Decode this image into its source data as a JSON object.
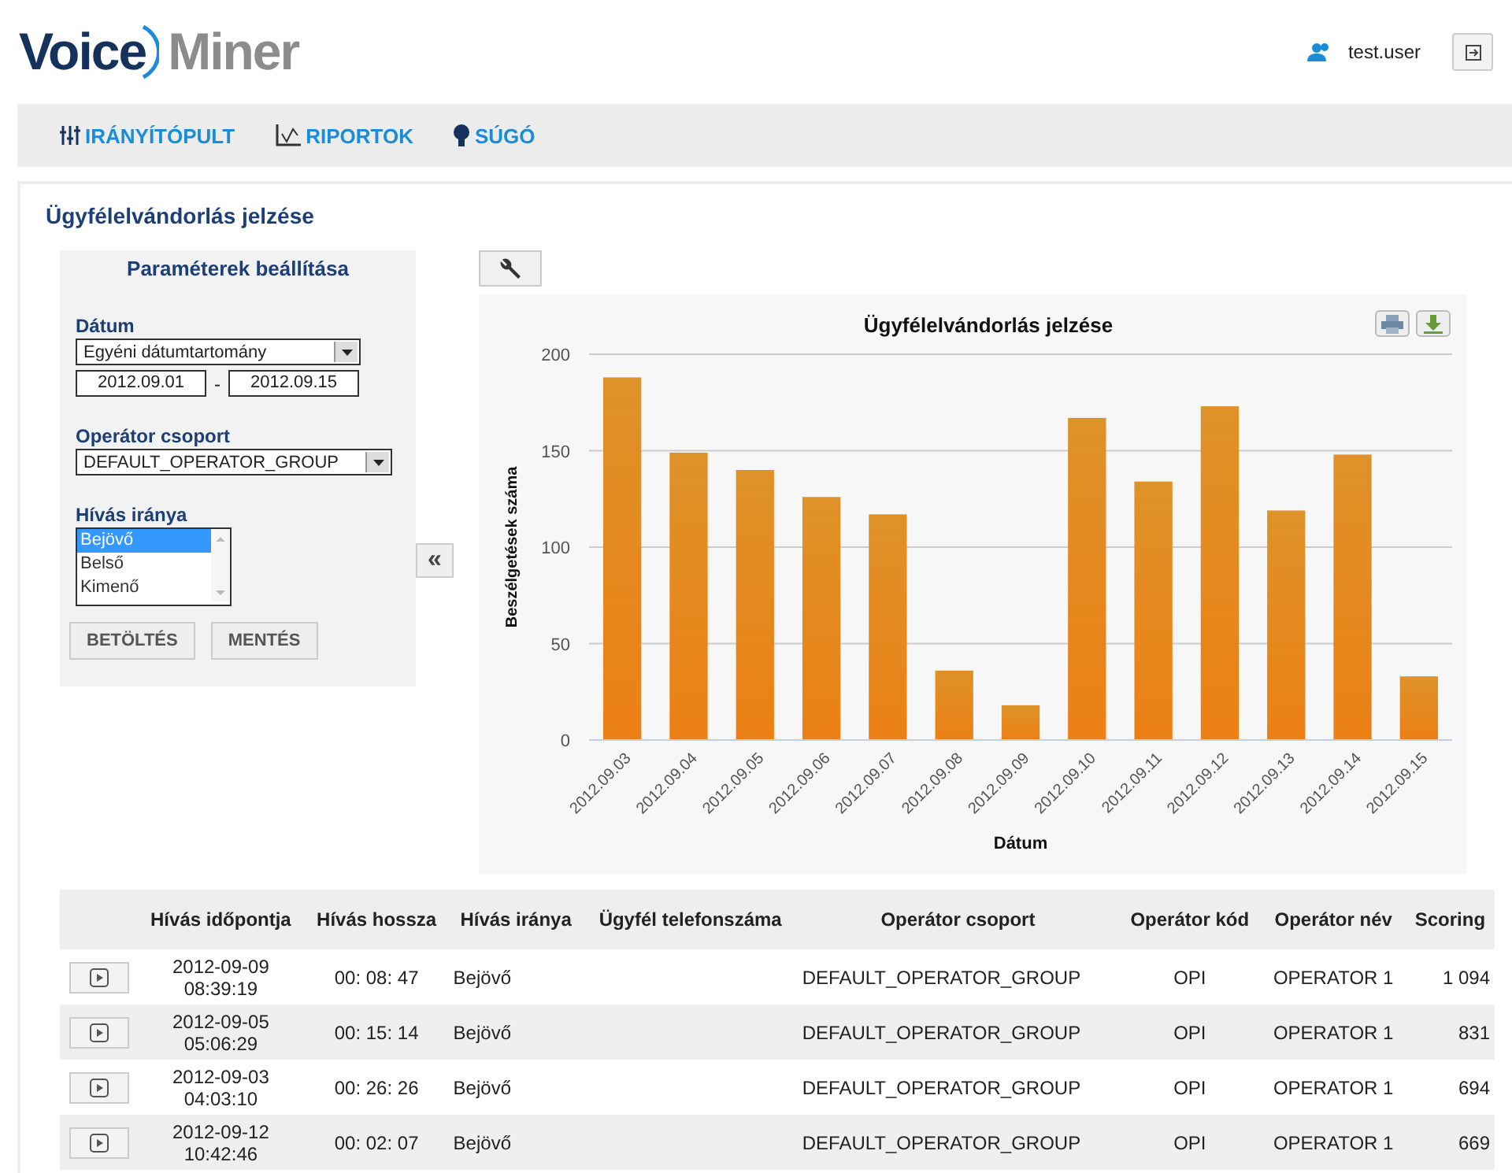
{
  "header": {
    "logo": {
      "part_1": "Voice",
      "part_2": "Miner"
    },
    "user": "test.user"
  },
  "nav": [
    {
      "label": "IRÁNYÍTÓPULT"
    },
    {
      "label": "RIPORTOK"
    },
    {
      "label": "SÚGÓ"
    }
  ],
  "page_title": "Ügyfélelvándorlás jelzése",
  "params": {
    "title": "Paraméterek beállítása",
    "date_label": "Dátum",
    "date_range": "Egyéni dátumtartomány",
    "date_from": "2012.09.01",
    "date_separator": "-",
    "date_to": "2012.09.15",
    "group_label": "Operátor csoport",
    "group": "DEFAULT_OPERATOR_GROUP",
    "direction_label": "Hívás iránya",
    "directions": [
      {
        "label": "Bejövő",
        "selected": true
      },
      {
        "label": "Belső",
        "selected": false
      },
      {
        "label": "Kimenő",
        "selected": false
      }
    ],
    "buttons": [
      "BETÖLTÉS",
      "MENTÉS"
    ],
    "collapse": "«"
  },
  "chart_data": {
    "type": "bar",
    "title": "Ügyfélelvándorlás jelzése",
    "xlabel": "Dátum",
    "ylabel": "Beszélgetések száma",
    "categories": [
      "2012.09.03",
      "2012.09.04",
      "2012.09.05",
      "2012.09.06",
      "2012.09.07",
      "2012.09.08",
      "2012.09.09",
      "2012.09.10",
      "2012.09.11",
      "2012.09.12",
      "2012.09.13",
      "2012.09.14",
      "2012.09.15"
    ],
    "grid": true,
    "series": [
      {
        "color": "#ec8014",
        "values": [
          188,
          149,
          140,
          126,
          117,
          36,
          18,
          167,
          134,
          173,
          119,
          148,
          33
        ]
      }
    ],
    "ylim": [
      0,
      200
    ],
    "yticks": [
      0,
      50,
      100,
      150,
      200
    ]
  },
  "table": {
    "columns": [
      "",
      "Hívás időpontja",
      "Hívás hossza",
      "Hívás iránya",
      "Ügyfél telefonszáma",
      "Operátor csoport",
      "Operátor kód",
      "Operátor név",
      "Scoring"
    ],
    "rows": [
      {
        "date": "2012-09-09",
        "time": "08:39:19",
        "length": "00: 08: 47",
        "direction": "Bejövő",
        "phone": "",
        "group": "DEFAULT_OPERATOR_GROUP",
        "code": "OPI",
        "name": "OPERATOR 1",
        "scoring": "1 094"
      },
      {
        "date": "2012-09-05",
        "time": "05:06:29",
        "length": "00: 15: 14",
        "direction": "Bejövő",
        "phone": "",
        "group": "DEFAULT_OPERATOR_GROUP",
        "code": "OPI",
        "name": "OPERATOR 1",
        "scoring": "831"
      },
      {
        "date": "2012-09-03",
        "time": "04:03:10",
        "length": "00: 26: 26",
        "direction": "Bejövő",
        "phone": "",
        "group": "DEFAULT_OPERATOR_GROUP",
        "code": "OPI",
        "name": "OPERATOR 1",
        "scoring": "694"
      },
      {
        "date": "2012-09-12",
        "time": "10:42:46",
        "length": "00: 02: 07",
        "direction": "Bejövő",
        "phone": "",
        "group": "DEFAULT_OPERATOR_GROUP",
        "code": "OPI",
        "name": "OPERATOR 1",
        "scoring": "669"
      }
    ]
  }
}
